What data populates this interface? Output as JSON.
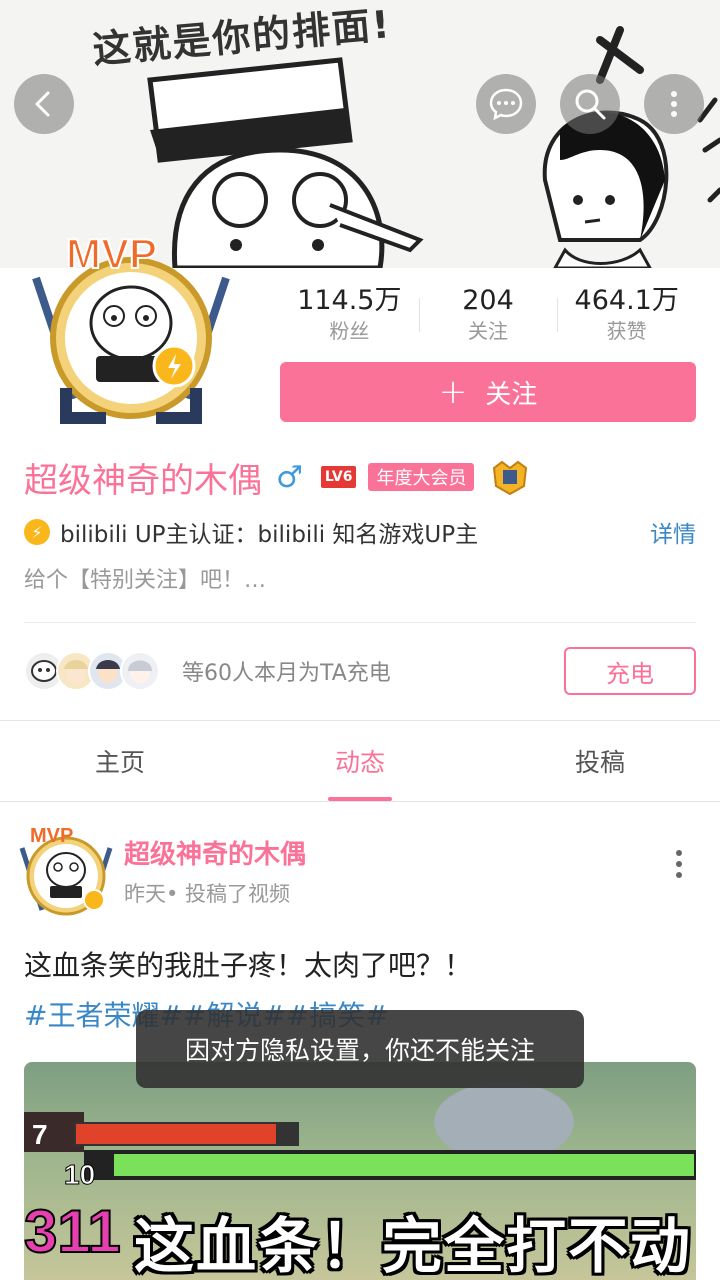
{
  "banner": {
    "caption": "这就是你的排面!"
  },
  "header_icons": {
    "back": "chevron-left-icon",
    "message": "chat-bubble-icon",
    "search": "search-icon",
    "more": "more-vertical-icon"
  },
  "stats": [
    {
      "value": "114.5万",
      "label": "粉丝"
    },
    {
      "value": "204",
      "label": "关注"
    },
    {
      "value": "464.1万",
      "label": "获赞"
    }
  ],
  "follow_button": {
    "plus": "+",
    "label": "关注"
  },
  "profile": {
    "name": "超级神奇的木偶",
    "gender_symbol": "♂",
    "level": "LV6",
    "vip": "年度大会员",
    "verify_text": "bilibili UP主认证：bilibili 知名游戏UP主",
    "detail_link": "详情",
    "sign": "给个【特别关注】吧！…"
  },
  "charge": {
    "text": "等60人本月为TA充电",
    "button": "充电"
  },
  "tabs": [
    {
      "label": "主页"
    },
    {
      "label": "动态"
    },
    {
      "label": "投稿"
    }
  ],
  "post": {
    "author": "超级神奇的木偶",
    "meta": "昨天• 投稿了视频",
    "text": "这血条笑的我肚子疼！太肉了吧？！",
    "tags": "#王者荣耀##解说##搞笑#",
    "video_caption": "这血条！完全打不动",
    "hud_numbers": [
      "7",
      "10",
      "311"
    ]
  },
  "toast": "因对方隐私设置，你还不能关注",
  "colors": {
    "brand_pink": "#fb7299",
    "link_blue": "#3a87c6"
  }
}
